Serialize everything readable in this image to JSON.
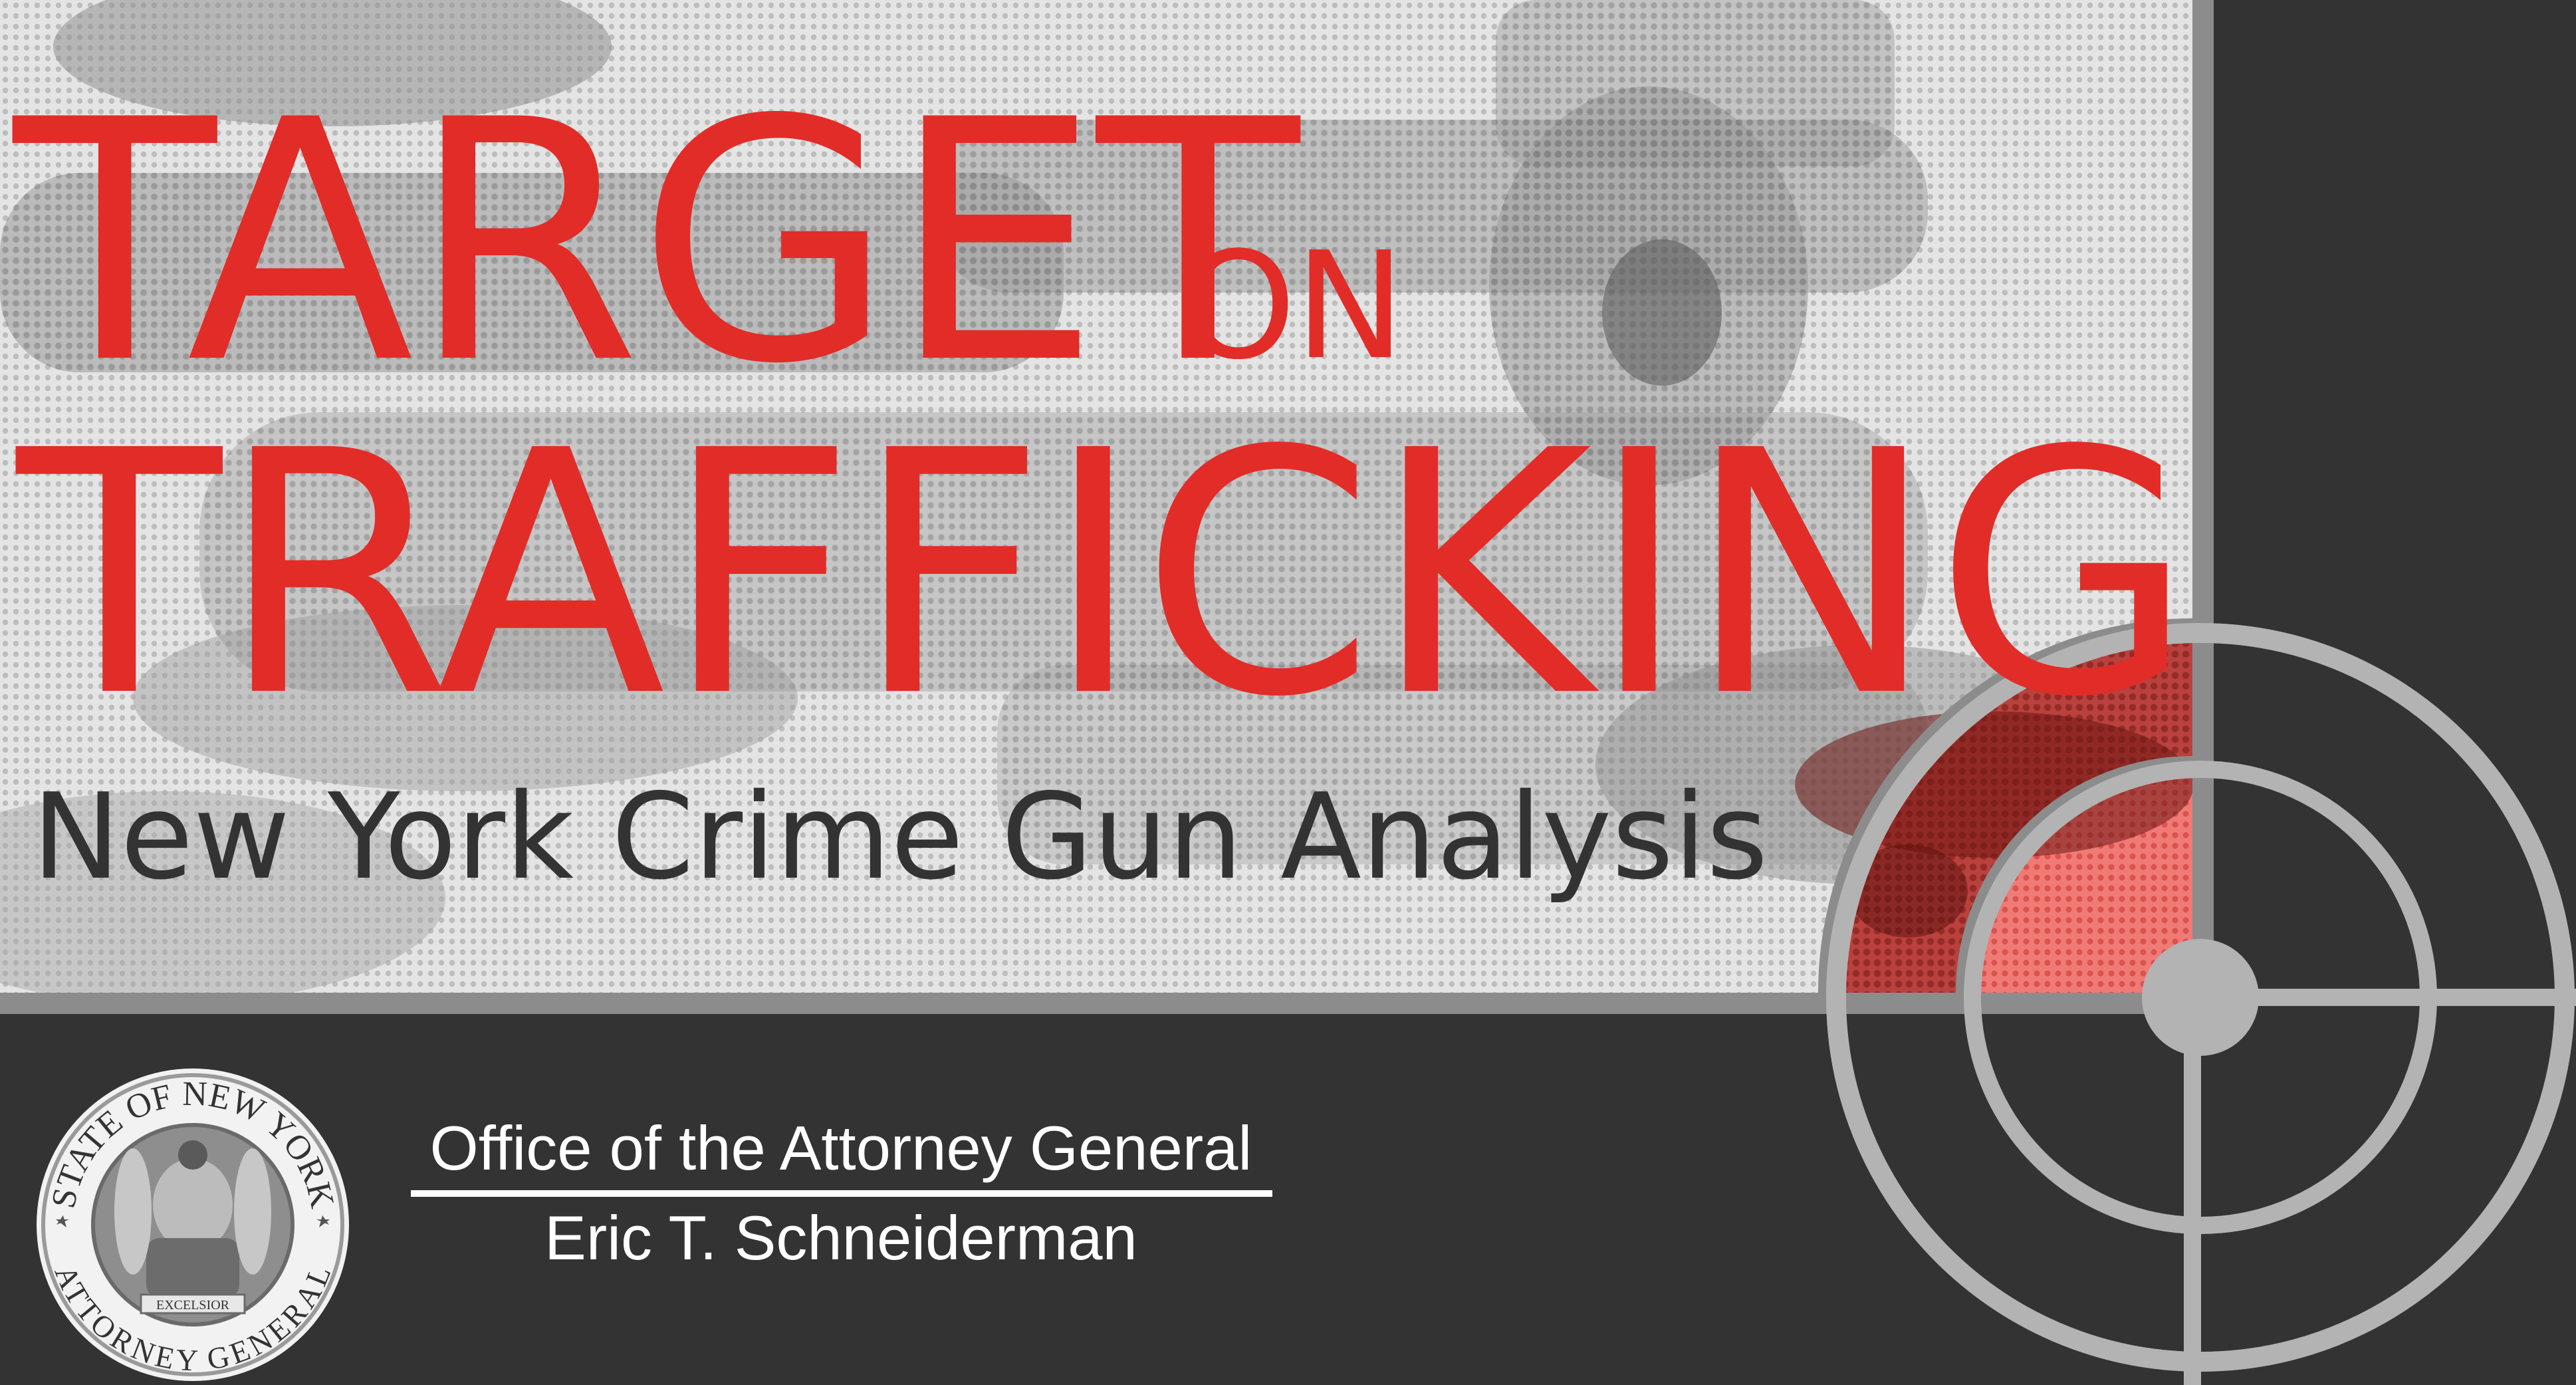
{
  "title": {
    "word1": "TARGET",
    "word2": "ON",
    "word3": "TRAFFICKING"
  },
  "subtitle": "New York Crime Gun Analysis",
  "footer": {
    "office": "Office of the Attorney General",
    "person": "Eric T. Schneiderman"
  },
  "seal": {
    "top_text": "STATE OF NEW YORK",
    "bottom_text": "ATTORNEY GENERAL",
    "motto": "EXCELSIOR"
  },
  "colors": {
    "accent_red": "#e22c28",
    "dark_panel": "#333333",
    "photo_gray": "#b3b3b3",
    "target_ring": "#b3b3b3"
  },
  "icons": [
    "crosshair-target-icon",
    "seal-logo"
  ]
}
